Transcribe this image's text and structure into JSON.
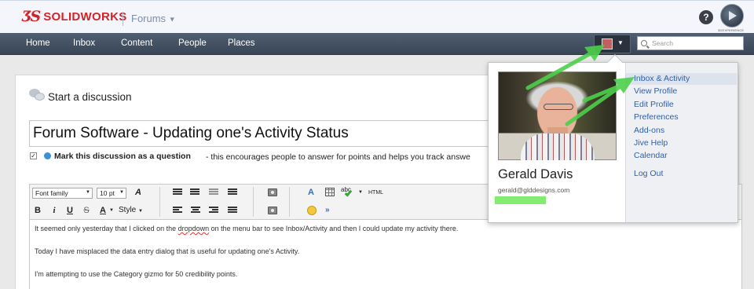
{
  "header": {
    "logo_mark": "𝔇S",
    "logo_text": "SOLIDWORKS",
    "forums_label": "Forums",
    "help_label": "?",
    "brand_label": "3DEXPERIENCE"
  },
  "nav": {
    "items": [
      "Home",
      "Inbox",
      "Content",
      "People",
      "Places"
    ],
    "search_placeholder": "Search"
  },
  "page": {
    "title": "Start a discussion",
    "subject_value": "Forum Software - Updating one's Activity Status",
    "question_checked": true,
    "question_label": "Mark this discussion as a question",
    "question_desc": "-  this encourages people to answer for points and helps you track answe"
  },
  "toolbar": {
    "font_family": "Font family",
    "font_size": "10 pt",
    "bold": "B",
    "italic": "i",
    "underline": "U",
    "strike": "S",
    "text_color": "A",
    "style": "Style",
    "html": "HTML",
    "more": "»"
  },
  "editor": {
    "para1_a": "It seemed only yesterday that I clicked on the ",
    "para1_b": "dropdown",
    "para1_c": " on the menu bar to see Inbox/Activity and then I could update my activity there.",
    "para2": "Today I have misplaced the data entry dialog that is useful for updating one's Activity.",
    "para3": "I'm attempting to use the Category gizmo for 50 credibility points."
  },
  "profile_menu": {
    "user_name": "Gerald Davis",
    "user_email": "gerald@glddesigns.com",
    "links": [
      "Inbox & Activity",
      "View Profile",
      "Edit Profile",
      "Preferences",
      "Add-ons",
      "Jive Help",
      "Calendar"
    ],
    "logout": "Log Out"
  },
  "annotation": {
    "arrow_color": "#4cd04a",
    "highlight_color": "#6fea58"
  }
}
